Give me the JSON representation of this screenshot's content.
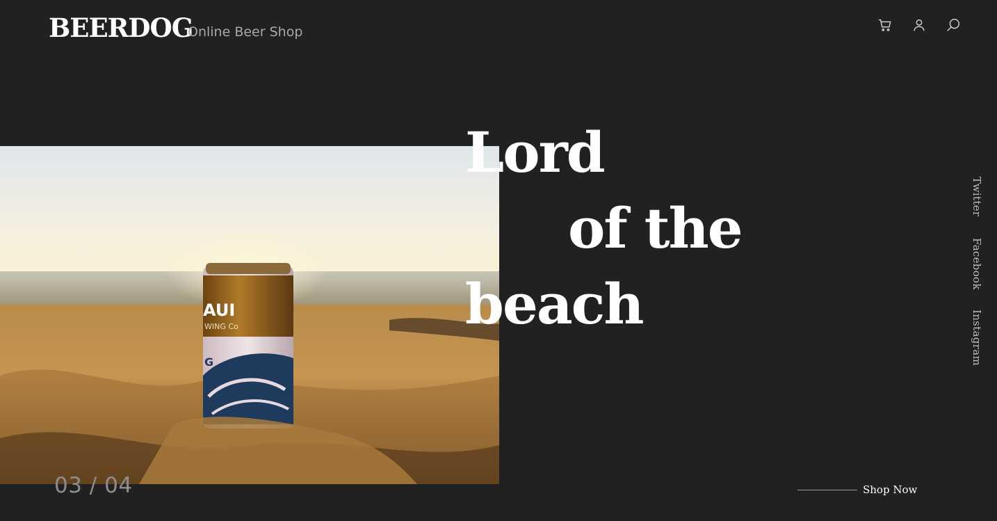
{
  "header": {
    "brand": "BEERDOG",
    "tagline": "Online Beer Shop",
    "icons": [
      "cart-icon",
      "user-icon",
      "search-icon"
    ]
  },
  "hero": {
    "title_lines": [
      "Lord",
      "of the",
      "beach"
    ],
    "image_description_icon": "beer-can-on-beach-photo"
  },
  "social": {
    "items": [
      "Twitter",
      "Facebook",
      "Instagram"
    ]
  },
  "slider": {
    "counter": "03 / 04"
  },
  "cta": {
    "label": "Shop Now"
  },
  "colors": {
    "background": "#212121",
    "text": "#ffffff",
    "muted": "#8d8d8d"
  }
}
